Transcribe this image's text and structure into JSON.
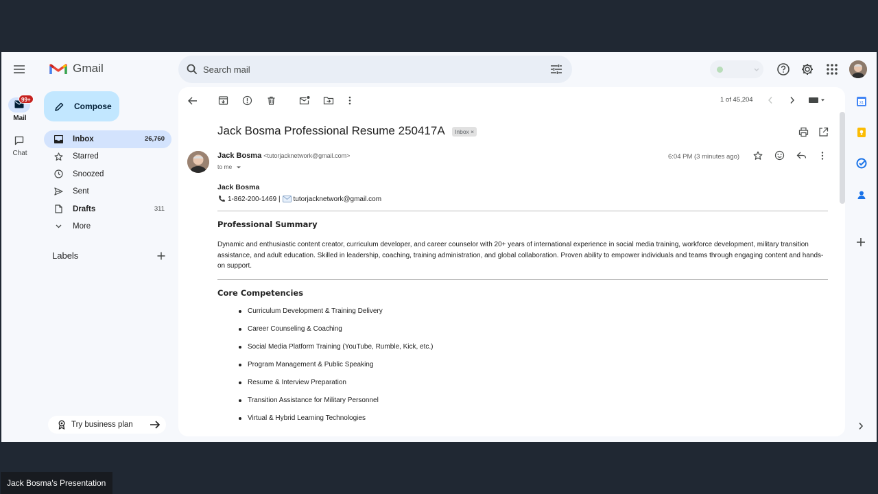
{
  "app": {
    "name": "Gmail",
    "search_placeholder": "Search mail"
  },
  "rail": {
    "mail_label": "Mail",
    "mail_badge": "99+",
    "chat_label": "Chat"
  },
  "nav": {
    "compose_label": "Compose",
    "items": [
      {
        "label": "Inbox",
        "count": "26,760",
        "icon": "inbox-icon"
      },
      {
        "label": "Starred",
        "count": "",
        "icon": "star-icon"
      },
      {
        "label": "Snoozed",
        "count": "",
        "icon": "clock-icon"
      },
      {
        "label": "Sent",
        "count": "",
        "icon": "send-icon"
      },
      {
        "label": "Drafts",
        "count": "311",
        "icon": "file-icon"
      },
      {
        "label": "More",
        "count": "",
        "icon": "chevron-down-icon"
      }
    ],
    "labels_heading": "Labels",
    "try_business": "Try business plan"
  },
  "message": {
    "counter": "1 of 45,204",
    "subject": "Jack Bosma Professional Resume 250417A",
    "inbox_chip": "Inbox ×",
    "sender_name": "Jack Bosma",
    "sender_email": "<tutorjacknetwork@gmail.com>",
    "recipient": "to me",
    "time": "6:04 PM (3 minutes ago)"
  },
  "resume": {
    "name": "Jack Bosma",
    "contact": "1-862-200-1469 |",
    "email": "tutorjacknetwork@gmail.com",
    "summary_heading": "Professional Summary",
    "summary_text": "Dynamic and enthusiastic content creator, curriculum developer, and career counselor with 20+ years of international experience in social media training, workforce development, military transition assistance, and adult education. Skilled in leadership, coaching, training administration, and global collaboration. Proven ability to empower individuals and teams through engaging content and hands-on support.",
    "competencies_heading": "Core Competencies",
    "competencies": [
      "Curriculum Development & Training Delivery",
      "Career Counseling & Coaching",
      "Social Media Platform Training (YouTube, Rumble, Kick, etc.)",
      "Program Management & Public Speaking",
      "Resume & Interview Preparation",
      "Transition Assistance for Military Personnel",
      "Virtual & Hybrid Learning Technologies"
    ]
  },
  "presentation_caption": "Jack Bosma's Presentation",
  "colors": {
    "background": "#202833",
    "gmail_surface": "#f6f8fc",
    "compose": "#c2e7ff",
    "active_nav": "#d3e3fd",
    "badge": "#c5221f"
  }
}
